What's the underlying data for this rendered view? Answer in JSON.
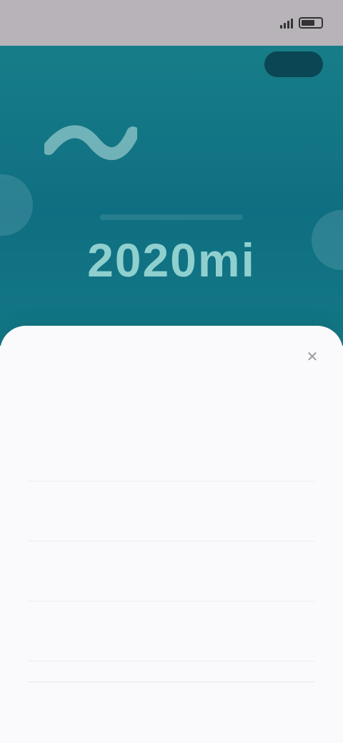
{
  "status_bar": {
    "time": ""
  },
  "hero": {
    "reading": "2020mi",
    "accent_color": "#0f6f82"
  },
  "sheet": {
    "title": "",
    "close_icon": "close-icon",
    "rows": [
      {
        "label": "",
        "value": ""
      },
      {
        "label": "",
        "value": ""
      },
      {
        "label": "",
        "value": ""
      },
      {
        "label": "",
        "value": ""
      }
    ]
  }
}
